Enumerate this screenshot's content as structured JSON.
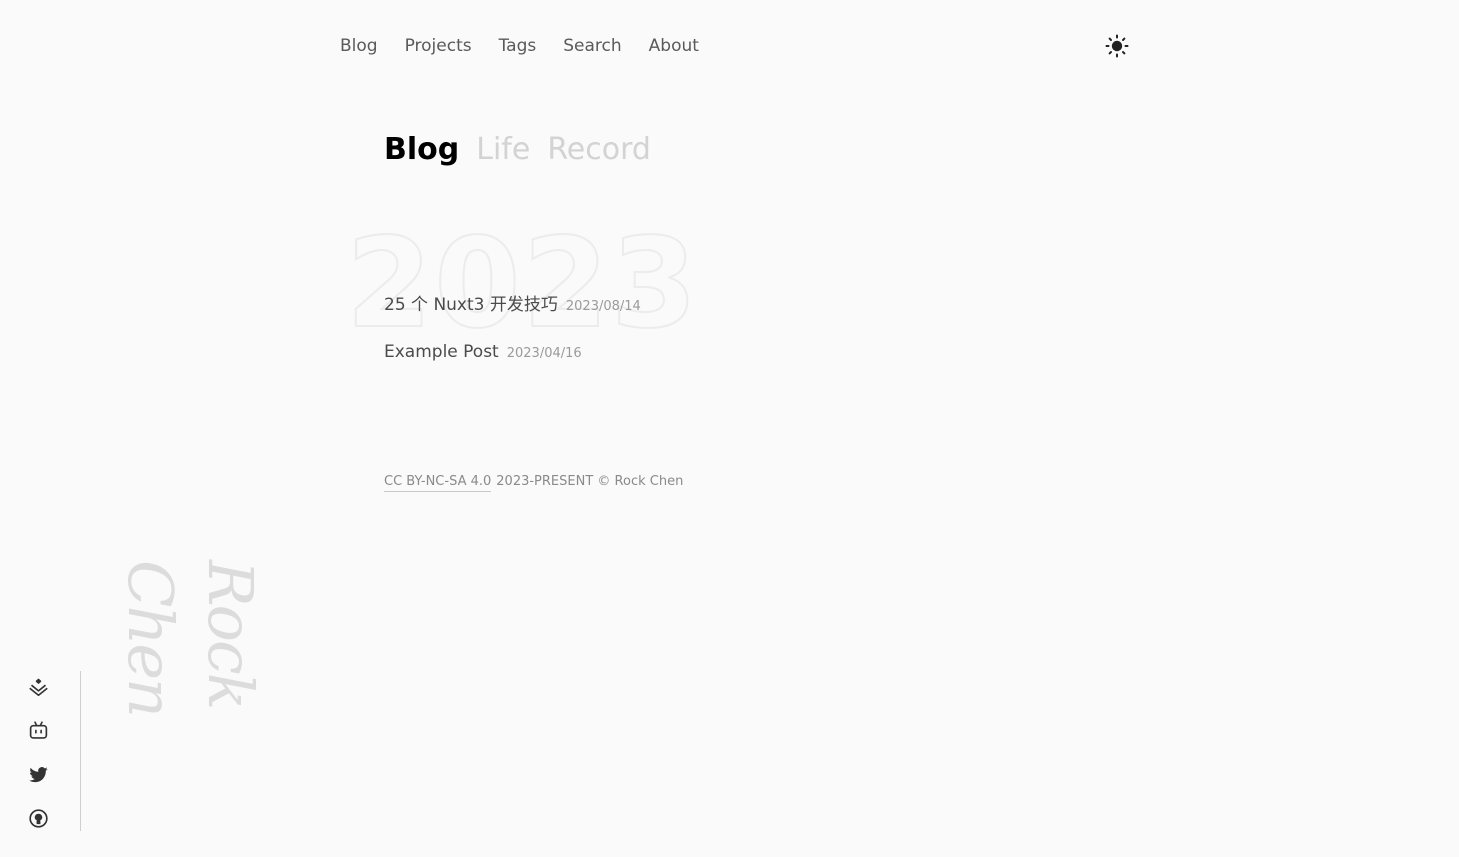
{
  "nav": {
    "items": [
      {
        "label": "Blog"
      },
      {
        "label": "Projects"
      },
      {
        "label": "Tags"
      },
      {
        "label": "Search"
      },
      {
        "label": "About"
      }
    ],
    "theme_icon": "sun-icon"
  },
  "tabs": {
    "active": "Blog",
    "others": [
      "Life",
      "Record"
    ]
  },
  "year": "2023",
  "posts": [
    {
      "title": "25 个 Nuxt3 开发技巧",
      "date": "2023/08/14"
    },
    {
      "title": "Example Post",
      "date": "2023/04/16"
    }
  ],
  "footer": {
    "license": "CC BY-NC-SA 4.0",
    "copyright": "2023-PRESENT © Rock Chen"
  },
  "social": [
    "juejin-icon",
    "bilibili-icon",
    "twitter-icon",
    "github-icon"
  ],
  "signature": "Rock Chen"
}
